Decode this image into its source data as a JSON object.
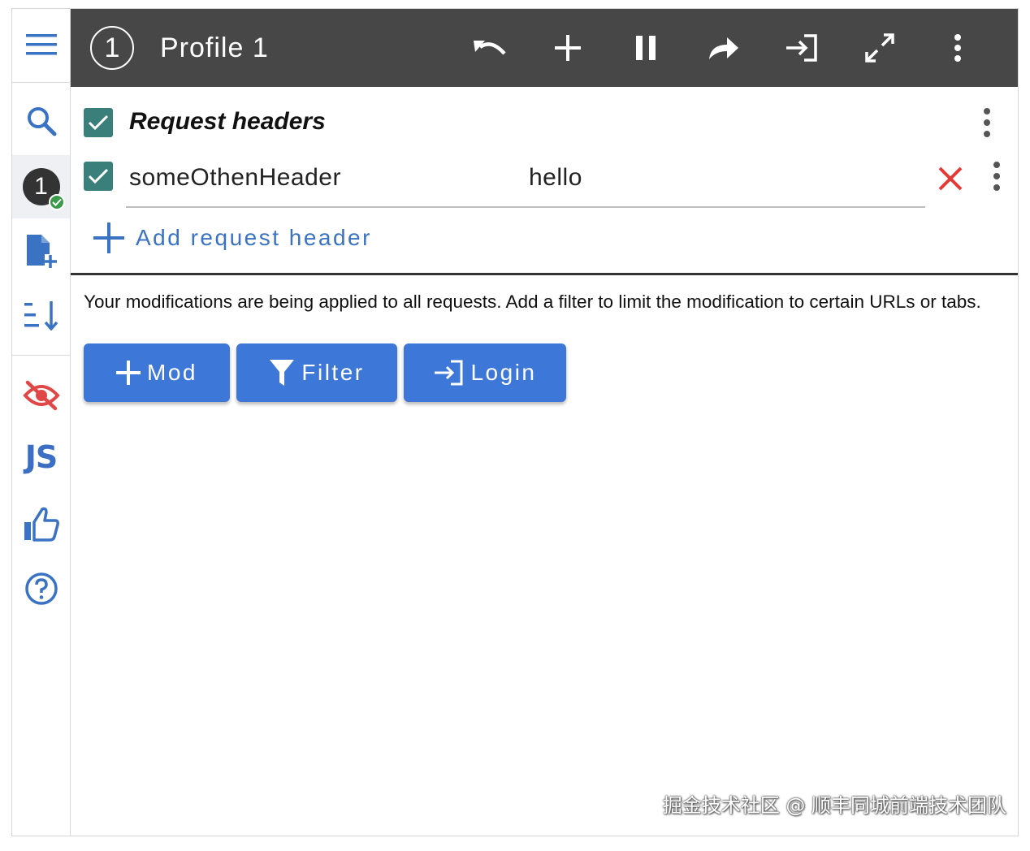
{
  "topbar": {
    "profile_number": "1",
    "profile_title": "Profile 1"
  },
  "sidebar": {
    "profile_badge": "1",
    "js_label": "JS"
  },
  "modifier": {
    "title": "Request headers",
    "header_name": "someOthenHeader",
    "header_value": "hello",
    "add_label": "Add request header"
  },
  "info_text": "Your modifications are being applied to all requests. Add a filter to limit the modification to certain URLs or tabs.",
  "actions": {
    "mod_label": "Mod",
    "filter_label": "Filter",
    "login_label": "Login"
  },
  "watermark": "掘金技术社区 @ 顺丰同城前端技术团队",
  "colors": {
    "topbar_bg": "#474747",
    "accent_blue": "#3d78d8",
    "checkbox_teal": "#3b7f7a",
    "delete_red": "#e53935",
    "badge_green": "#3b9b4b"
  }
}
